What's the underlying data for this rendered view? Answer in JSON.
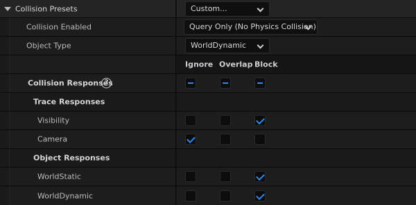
{
  "presets": {
    "label": "Collision Presets",
    "value": "Custom..."
  },
  "collision_enabled": {
    "label": "Collision Enabled",
    "value": "Query Only (No Physics Collision)"
  },
  "object_type": {
    "label": "Object Type",
    "value": "WorldDynamic"
  },
  "columns": [
    "Ignore",
    "Overlap",
    "Block"
  ],
  "collision_responses": {
    "label": "Collision Responses",
    "help": "?",
    "state": [
      "mixed",
      "mixed",
      "mixed"
    ]
  },
  "trace_responses": {
    "label": "Trace Responses",
    "rows": [
      {
        "label": "Visibility",
        "state": [
          false,
          false,
          true
        ]
      },
      {
        "label": "Camera",
        "state": [
          true,
          false,
          false
        ]
      }
    ]
  },
  "object_responses": {
    "label": "Object Responses",
    "rows": [
      {
        "label": "WorldStatic",
        "state": [
          false,
          false,
          true
        ]
      },
      {
        "label": "WorldDynamic",
        "state": [
          false,
          false,
          true
        ]
      }
    ]
  },
  "colors": {
    "accent": "#2a8cf0",
    "background": "#151515"
  }
}
